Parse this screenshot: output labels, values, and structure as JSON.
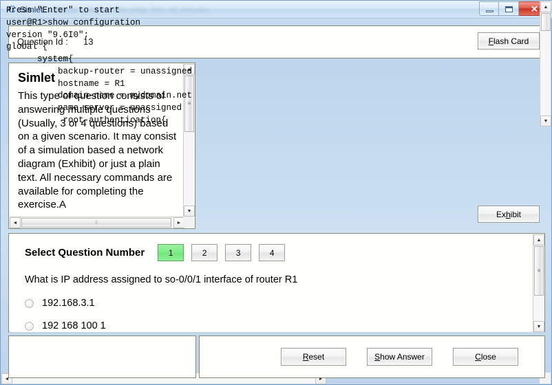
{
  "window": {
    "title": "Simlet",
    "title_suffix": "Actual screen at the edge Sim, n2 minutes",
    "icon": "C",
    "buttons": {
      "minimize": "minimize-icon",
      "maximize": "maximize-icon",
      "close": "✕"
    }
  },
  "header": {
    "question_id_label": "Question Id :",
    "question_id_value": "13",
    "flash_card_label_pre": "F",
    "flash_card_label_post": "lash Card"
  },
  "simlet": {
    "title": "Simlet",
    "body": "This type of question consists of answering multiple questions (Usually, 3 or 4 questions) based on a given scenario. It may consist of a simulation based a network diagram (Exhibit) or just a plain text.  All necessary commands are available for completing the exercise.A"
  },
  "terminal": {
    "lines": "Press \"Enter\" to start\nuser@R1>show configuration\nversion \"9.6I0\";\nglobal {\n      system{\n          backup-router = unassigned\n          hostname = R1\n          domain-name = mydomain.net\n          name-server = unassigned\n           root-authentication{"
  },
  "exhibit": {
    "label_pre": "Ex",
    "label_mid": "h",
    "label_post": "ibit"
  },
  "question": {
    "select_label": "Select Question Number",
    "numbers": [
      "1",
      "2",
      "3",
      "4"
    ],
    "selected_number": "1",
    "text": "What is IP address assigned to so-0/0/1 interface of router R1",
    "options": [
      {
        "label": "192.168.3.1",
        "selected": false
      },
      {
        "label": "192 168 100 1",
        "selected": false
      }
    ]
  },
  "actions": {
    "reset_pre": "R",
    "reset_post": "eset",
    "show_answer_pre": "S",
    "show_answer_post": "how Answer",
    "close_pre": "C",
    "close_post": "lose"
  },
  "scroll": {
    "up_arrow": "▲",
    "down_arrow": "▼",
    "left_arrow": "◄",
    "right_arrow": "►",
    "grip_v": "≡",
    "grip_h": "⦙⦙"
  },
  "colors": {
    "selected_question": "#7eec86",
    "titlebar": "#d6e7f7",
    "close_button": "#c63322",
    "panel_bg": "#fffffb"
  }
}
